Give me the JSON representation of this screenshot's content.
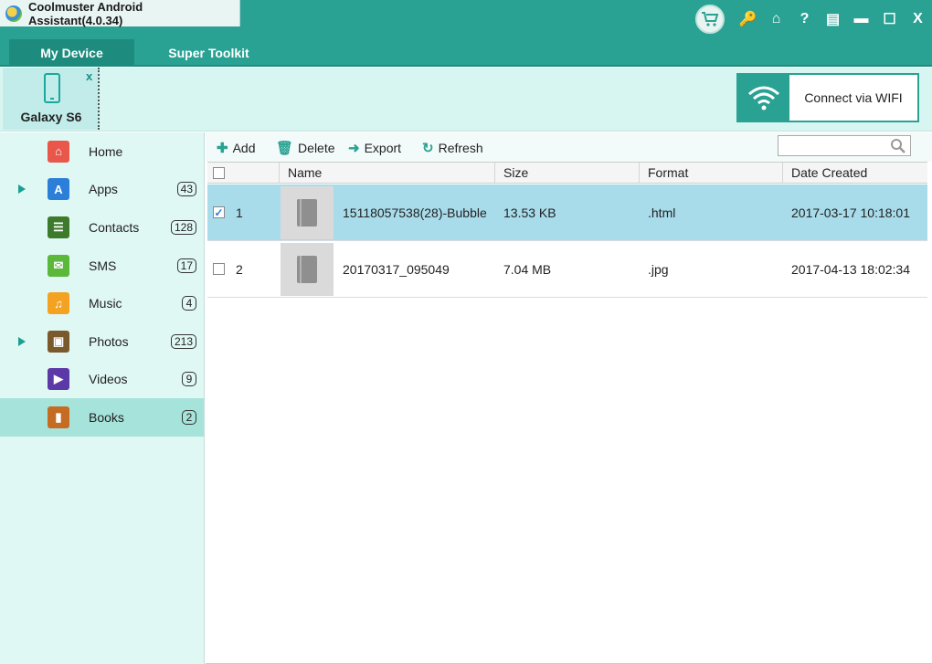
{
  "app": {
    "title": "Coolmuster Android Assistant(4.0.34)"
  },
  "window_controls": {
    "key": "🔑",
    "home": "⌂",
    "help": "?",
    "feedback": "▤",
    "minimize": "▬",
    "maximize": "☐",
    "close": "X"
  },
  "tabs": [
    {
      "label": "My Device",
      "active": true
    },
    {
      "label": "Super Toolkit",
      "active": false
    }
  ],
  "device": {
    "name": "Galaxy S6",
    "close": "x"
  },
  "wifi": {
    "label": "Connect via WIFI"
  },
  "sidebar": {
    "items": [
      {
        "label": "Home",
        "count": "",
        "icon": "home-icon",
        "color": "#e8574a",
        "expandable": false,
        "active": false
      },
      {
        "label": "Apps",
        "count": "43",
        "icon": "apps-icon",
        "color": "#2b7fd8",
        "expandable": true,
        "active": false
      },
      {
        "label": "Contacts",
        "count": "128",
        "icon": "contacts-icon",
        "color": "#3e7a2c",
        "expandable": false,
        "active": false
      },
      {
        "label": "SMS",
        "count": "17",
        "icon": "sms-icon",
        "color": "#5bb83a",
        "expandable": false,
        "active": false
      },
      {
        "label": "Music",
        "count": "4",
        "icon": "music-icon",
        "color": "#f3a221",
        "expandable": false,
        "active": false
      },
      {
        "label": "Photos",
        "count": "213",
        "icon": "photos-icon",
        "color": "#7a5a2c",
        "expandable": true,
        "active": false
      },
      {
        "label": "Videos",
        "count": "9",
        "icon": "videos-icon",
        "color": "#5b3aa8",
        "expandable": false,
        "active": false
      },
      {
        "label": "Books",
        "count": "2",
        "icon": "books-icon",
        "color": "#c56b22",
        "expandable": false,
        "active": true
      }
    ]
  },
  "toolbar": {
    "add": "Add",
    "delete": "Delete",
    "export": "Export",
    "refresh": "Refresh",
    "search_placeholder": ""
  },
  "table": {
    "headers": {
      "name": "Name",
      "size": "Size",
      "format": "Format",
      "date": "Date Created"
    },
    "rows": [
      {
        "index": "1",
        "name": "15118057538(28)-Bubble",
        "size": "13.53 KB",
        "format": ".html",
        "date": "2017-03-17 10:18:01",
        "checked": true
      },
      {
        "index": "2",
        "name": "20170317_095049",
        "size": "7.04 MB",
        "format": ".jpg",
        "date": "2017-04-13 18:02:34",
        "checked": false
      }
    ]
  }
}
